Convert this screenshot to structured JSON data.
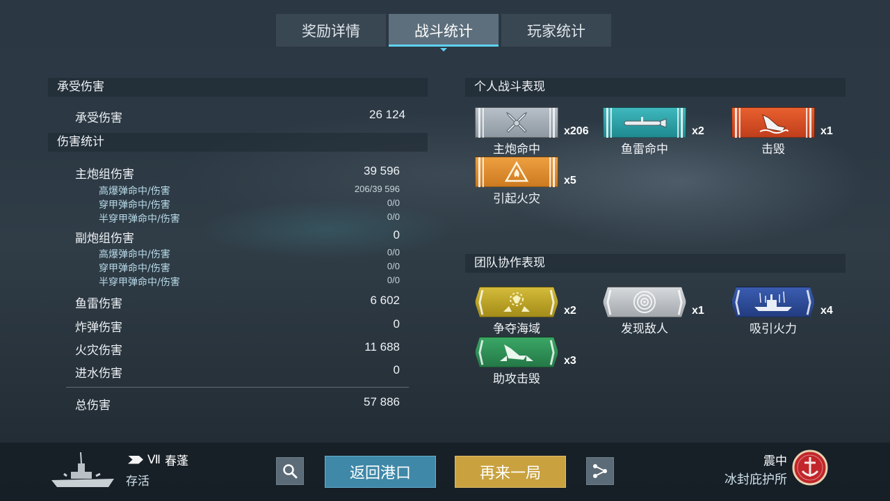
{
  "tabs": [
    {
      "label": "奖励详情",
      "active": false
    },
    {
      "label": "战斗统计",
      "active": true
    },
    {
      "label": "玩家统计",
      "active": false
    }
  ],
  "damage_taken": {
    "header": "承受伤害",
    "label": "承受伤害",
    "value": "26 124"
  },
  "damage_stats": {
    "header": "伤害统计",
    "main_battery": {
      "label": "主炮组伤害",
      "value": "39 596",
      "he": {
        "label": "高爆弹命中/伤害",
        "value": "206/39 596"
      },
      "ap": {
        "label": "穿甲弹命中/伤害",
        "value": "0/0"
      },
      "sap": {
        "label": "半穿甲弹命中/伤害",
        "value": "0/0"
      }
    },
    "secondary": {
      "label": "副炮组伤害",
      "value": "0",
      "he": {
        "label": "高爆弹命中/伤害",
        "value": "0/0"
      },
      "ap": {
        "label": "穿甲弹命中/伤害",
        "value": "0/0"
      },
      "sap": {
        "label": "半穿甲弹命中/伤害",
        "value": "0/0"
      }
    },
    "torpedo": {
      "label": "鱼雷伤害",
      "value": "6 602"
    },
    "bomb": {
      "label": "炸弹伤害",
      "value": "0"
    },
    "fire": {
      "label": "火灾伤害",
      "value": "11 688"
    },
    "flooding": {
      "label": "进水伤害",
      "value": "0"
    },
    "total": {
      "label": "总伤害",
      "value": "57 886"
    }
  },
  "personal": {
    "header": "个人战斗表现",
    "awards": [
      {
        "name": "主炮命中",
        "count": "x206",
        "icon": "crossed-shells-icon",
        "color": "#9aa4ae"
      },
      {
        "name": "鱼雷命中",
        "count": "x2",
        "icon": "torpedo-icon",
        "color": "#2aa0a6"
      },
      {
        "name": "击毁",
        "count": "x1",
        "icon": "sinking-ship-icon",
        "color": "#d9532a"
      },
      {
        "name": "引起火灾",
        "count": "x5",
        "icon": "fire-icon",
        "color": "#dd8a2a"
      }
    ]
  },
  "team": {
    "header": "团队协作表现",
    "awards": [
      {
        "name": "争夺海域",
        "count": "x2",
        "icon": "capture-icon",
        "color": "#b9a128"
      },
      {
        "name": "发现敌人",
        "count": "x1",
        "icon": "radar-icon",
        "color": "#b8bcc0"
      },
      {
        "name": "吸引火力",
        "count": "x4",
        "icon": "tank-ship-icon",
        "color": "#2c4a96"
      },
      {
        "name": "助攻击毁",
        "count": "x3",
        "icon": "assist-kill-icon",
        "color": "#2d8f55"
      }
    ]
  },
  "footer": {
    "ship_tier": "Ⅶ",
    "ship_name": "春蓬",
    "ship_status": "存活",
    "return_label": "返回港口",
    "again_label": "再来一局",
    "map_top": "震中",
    "map_name": "冰封庇护所"
  }
}
